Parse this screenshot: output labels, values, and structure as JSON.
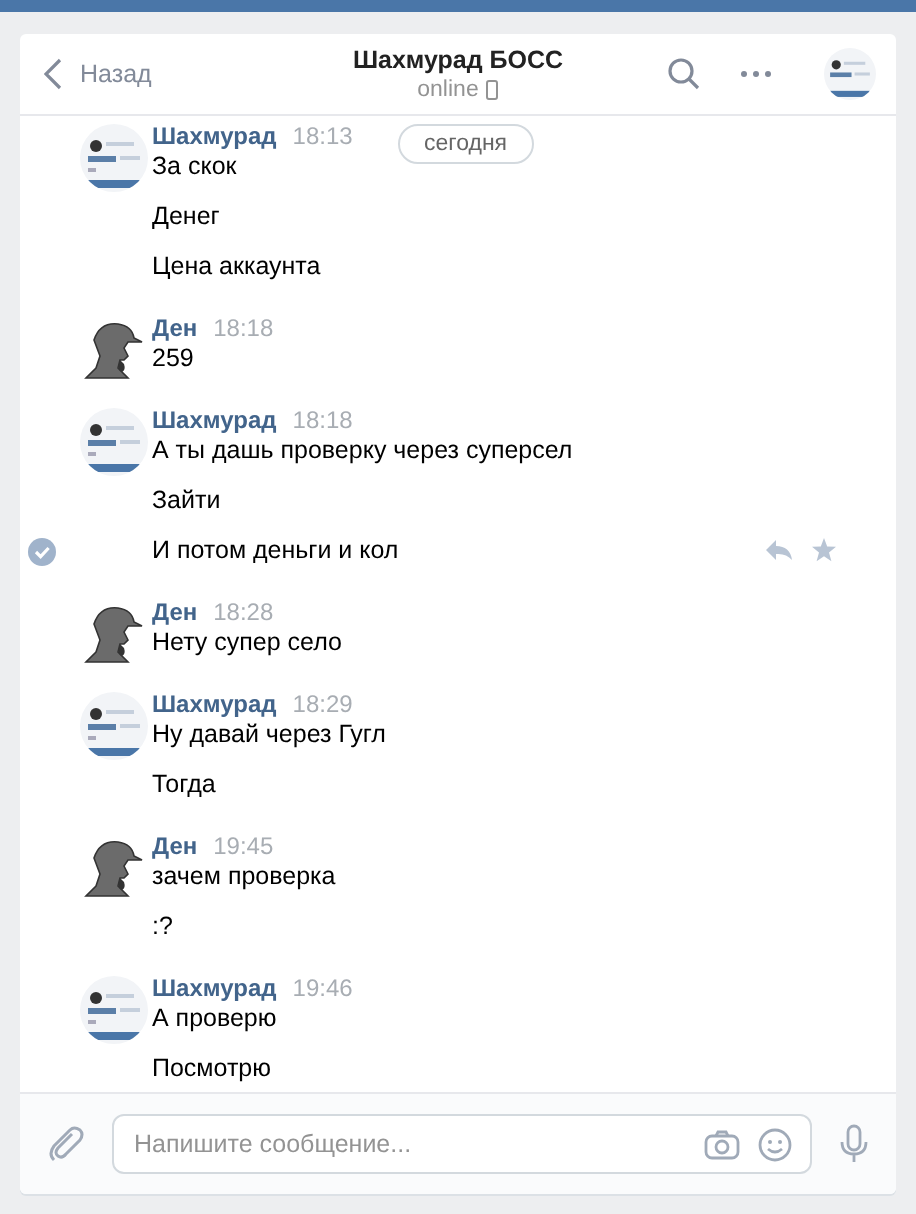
{
  "header": {
    "back": "Назад",
    "title": "Шахмурад БОСС",
    "status": "online"
  },
  "date_pill": "сегодня",
  "messages": [
    {
      "author": "Шахмурад",
      "time": "18:13",
      "kind": "picture",
      "lines": [
        {
          "text": "За скок",
          "selected": false
        },
        {
          "text": "Денег",
          "selected": false
        },
        {
          "text": "Цена аккаунта",
          "selected": false
        }
      ]
    },
    {
      "author": "Ден",
      "time": "18:18",
      "kind": "detective",
      "lines": [
        {
          "text": "259",
          "selected": false
        }
      ]
    },
    {
      "author": "Шахмурад",
      "time": "18:18",
      "kind": "picture",
      "lines": [
        {
          "text": "А ты дашь проверку через суперсел",
          "selected": false
        },
        {
          "text": "Зайти",
          "selected": false
        },
        {
          "text": "И потом деньги и кол",
          "selected": true
        }
      ]
    },
    {
      "author": "Ден",
      "time": "18:28",
      "kind": "detective",
      "lines": [
        {
          "text": "Нету супер село",
          "selected": false
        }
      ]
    },
    {
      "author": "Шахмурад",
      "time": "18:29",
      "kind": "picture",
      "lines": [
        {
          "text": "Ну давай через Гугл",
          "selected": false
        },
        {
          "text": "Тогда",
          "selected": false
        }
      ]
    },
    {
      "author": "Ден",
      "time": "19:45",
      "kind": "detective",
      "lines": [
        {
          "text": "зачем проверка",
          "selected": false
        },
        {
          "text": ":?",
          "selected": false
        }
      ]
    },
    {
      "author": "Шахмурад",
      "time": "19:46",
      "kind": "picture",
      "lines": [
        {
          "text": "А проверю",
          "selected": false
        },
        {
          "text": "Посмотрю",
          "selected": false
        }
      ]
    }
  ],
  "composer": {
    "placeholder": "Напишите сообщение..."
  }
}
